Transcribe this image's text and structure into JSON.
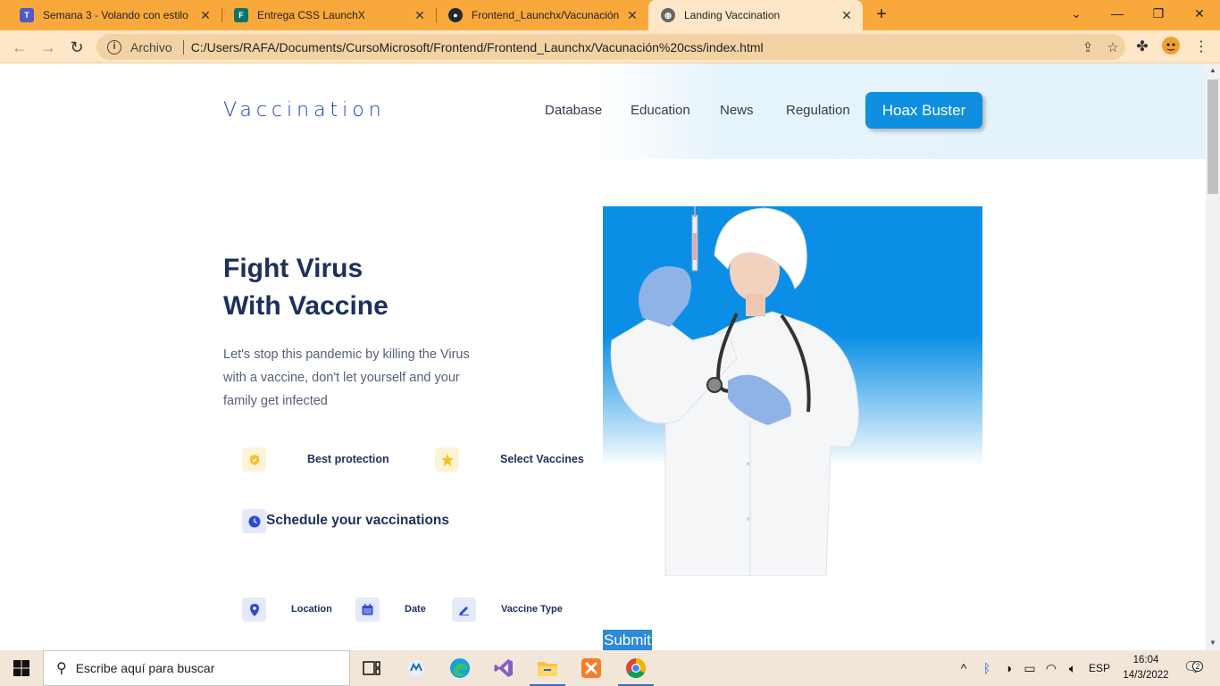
{
  "browser": {
    "tabs": [
      {
        "title": "Semana 3 - Volando con estilo",
        "icon": "teams-icon",
        "color": "#5059c9",
        "active": false
      },
      {
        "title": "Entrega CSS LaunchX",
        "icon": "forms-icon",
        "color": "#077568",
        "active": false
      },
      {
        "title": "Frontend_Launchx/Vacunación css",
        "icon": "github-icon",
        "color": "#24292f",
        "active": false
      },
      {
        "title": "Landing Vaccination",
        "icon": "globe-icon",
        "color": "#555555",
        "active": true
      }
    ],
    "omnibox": {
      "label": "Archivo",
      "url": "C:/Users/RAFA/Documents/CursoMicrosoft/Frontend/Frontend_Launchx/Vacunación%20css/index.html"
    },
    "accent": "#f9a93b"
  },
  "page": {
    "logo": "Vaccination",
    "nav": [
      "Database",
      "Education",
      "News",
      "Regulation"
    ],
    "cta": "Hoax Buster",
    "hero_title_line1": "Fight Virus",
    "hero_title_line2": "With Vaccine",
    "hero_text": "Let's stop this pandemic by killing the Virus with a vaccine, don't let yourself and your family get infected",
    "features": [
      {
        "label": "Best protection",
        "icon": "shield-icon"
      },
      {
        "label": "Select Vaccines",
        "icon": "star-icon"
      }
    ],
    "schedule_title": "Schedule your vaccinations",
    "fields": [
      {
        "label": "Location",
        "icon": "location-pin-icon"
      },
      {
        "label": "Date",
        "icon": "calendar-icon"
      },
      {
        "label": "Vaccine Type",
        "icon": "pen-icon"
      }
    ],
    "submit": "Submit",
    "primary_color": "#0f8fe0",
    "heading_color": "#1c2f5e"
  },
  "taskbar": {
    "search_placeholder": "Escribe aquí para buscar",
    "language": "ESP",
    "time": "16:04",
    "date": "14/3/2022",
    "notification_count": "2"
  }
}
